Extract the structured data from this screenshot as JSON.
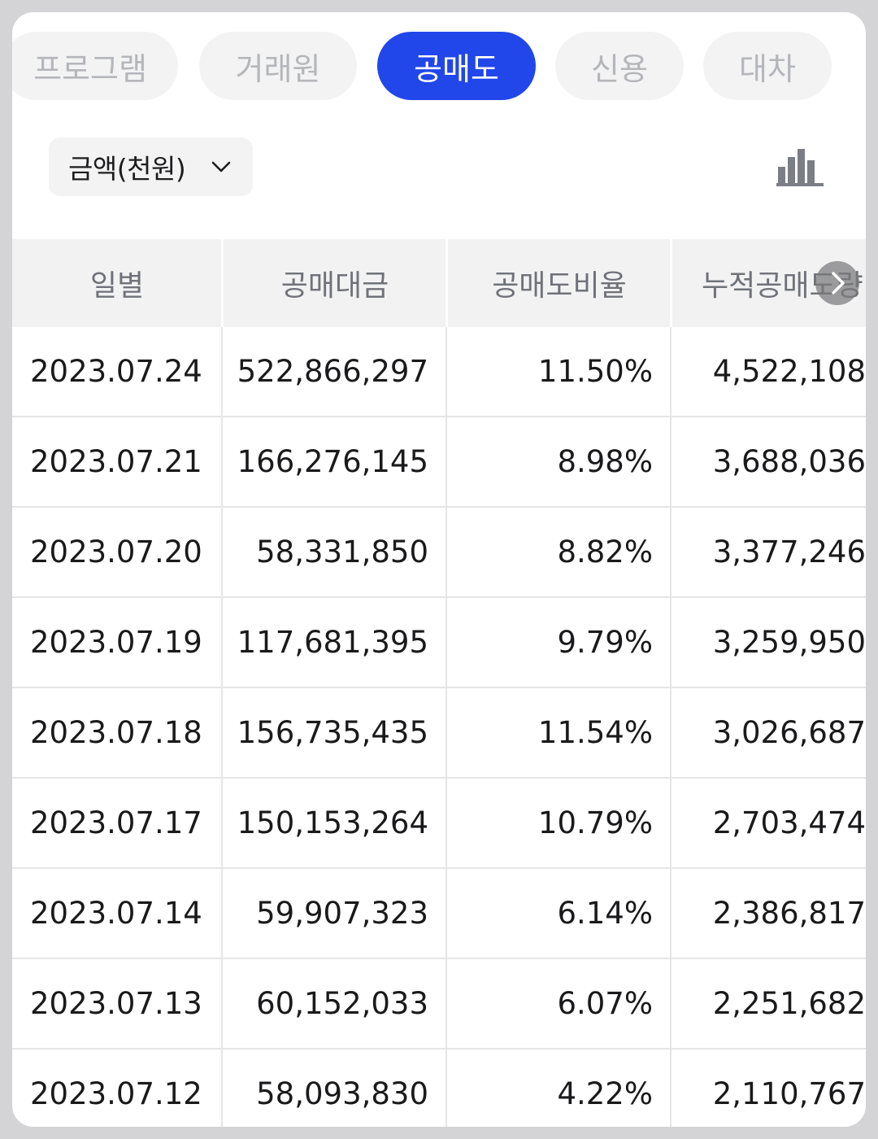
{
  "tabs": [
    {
      "label": "프로그램",
      "active": false
    },
    {
      "label": "거래원",
      "active": false
    },
    {
      "label": "공매도",
      "active": true
    },
    {
      "label": "신용",
      "active": false
    },
    {
      "label": "대차",
      "active": false
    }
  ],
  "filter": {
    "unit_label": "금액(천원)",
    "chart_toggle_icon": "bar-chart-icon"
  },
  "table": {
    "headers": [
      "일별",
      "공매대금",
      "공매도비율",
      "누적공매도량"
    ],
    "rows": [
      {
        "date": "2023.07.24",
        "amount": "522,866,297",
        "ratio": "11.50%",
        "cumulative": "4,522,108"
      },
      {
        "date": "2023.07.21",
        "amount": "166,276,145",
        "ratio": "8.98%",
        "cumulative": "3,688,036"
      },
      {
        "date": "2023.07.20",
        "amount": "58,331,850",
        "ratio": "8.82%",
        "cumulative": "3,377,246"
      },
      {
        "date": "2023.07.19",
        "amount": "117,681,395",
        "ratio": "9.79%",
        "cumulative": "3,259,950"
      },
      {
        "date": "2023.07.18",
        "amount": "156,735,435",
        "ratio": "11.54%",
        "cumulative": "3,026,687"
      },
      {
        "date": "2023.07.17",
        "amount": "150,153,264",
        "ratio": "10.79%",
        "cumulative": "2,703,474"
      },
      {
        "date": "2023.07.14",
        "amount": "59,907,323",
        "ratio": "6.14%",
        "cumulative": "2,386,817"
      },
      {
        "date": "2023.07.13",
        "amount": "60,152,033",
        "ratio": "6.07%",
        "cumulative": "2,251,682"
      },
      {
        "date": "2023.07.12",
        "amount": "58,093,830",
        "ratio": "4.22%",
        "cumulative": "2,110,767"
      }
    ]
  },
  "colors": {
    "accent": "#2147ea",
    "tab_inactive_bg": "#f3f3f4",
    "tab_inactive_text": "#b4b6ba",
    "header_bg": "#f2f2f3"
  }
}
